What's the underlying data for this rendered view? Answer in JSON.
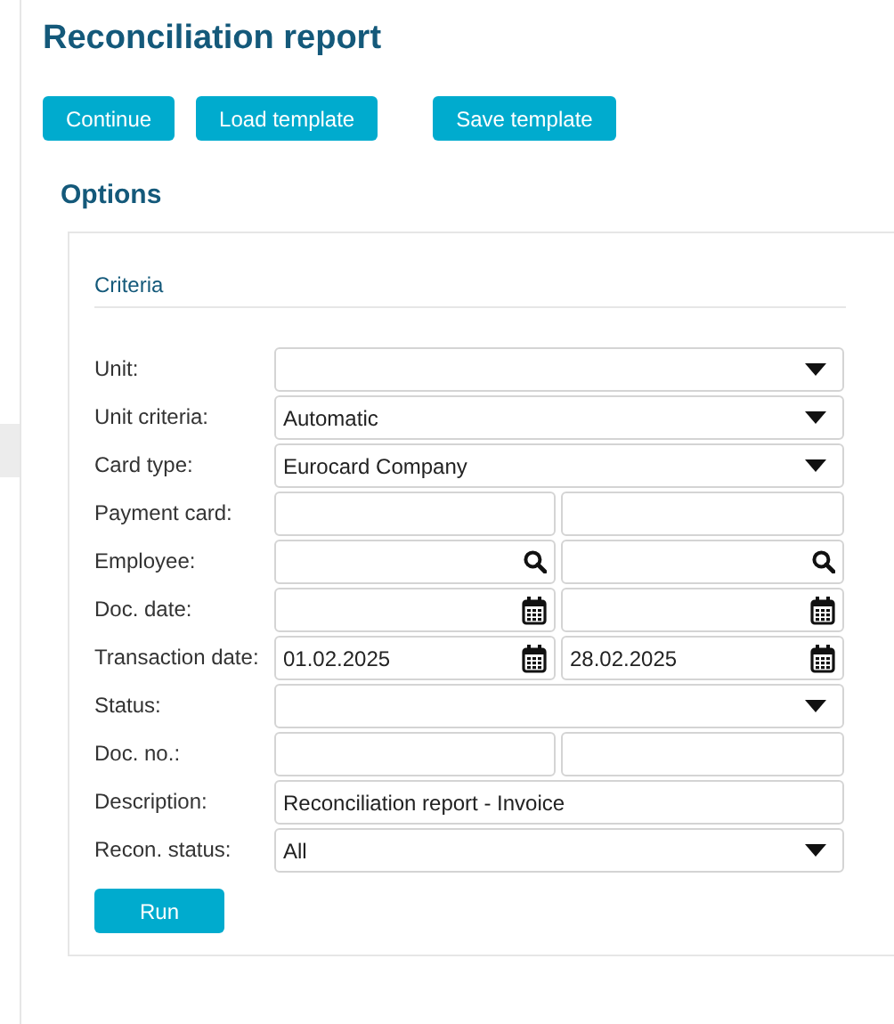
{
  "title": "Reconciliation report",
  "buttons": [
    "Continue",
    "Load template",
    "Save template"
  ],
  "options": {
    "heading": "Options",
    "section": "Criteria",
    "rows": [
      {
        "label": "Unit:",
        "kind": "select",
        "value": ""
      },
      {
        "label": "Unit criteria:",
        "kind": "select",
        "value": "Automatic"
      },
      {
        "label": "Card type:",
        "kind": "select",
        "value": "Eurocard Company"
      },
      {
        "label": "Payment card:",
        "kind": "range",
        "from": "",
        "to": ""
      },
      {
        "label": "Employee:",
        "kind": "lookup-range",
        "from": "",
        "to": ""
      },
      {
        "label": "Doc. date:",
        "kind": "date-range",
        "from": "",
        "to": ""
      },
      {
        "label": "Transaction date:",
        "kind": "date-range",
        "from": "01.02.2025",
        "to": "28.02.2025"
      },
      {
        "label": "Status:",
        "kind": "select",
        "value": ""
      },
      {
        "label": "Doc. no.:",
        "kind": "range",
        "from": "",
        "to": ""
      },
      {
        "label": "Description:",
        "kind": "text",
        "value": "Reconciliation report - Invoice"
      },
      {
        "label": "Recon. status:",
        "kind": "select",
        "value": "All"
      }
    ],
    "run_button": "Run"
  }
}
